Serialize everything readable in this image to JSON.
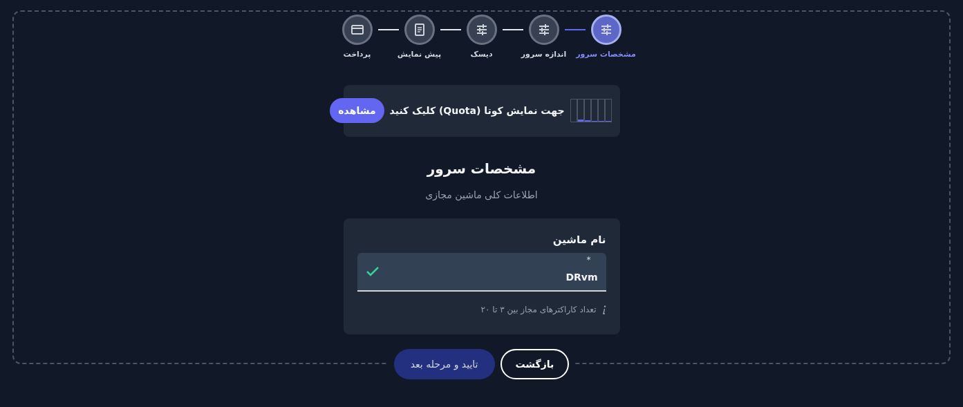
{
  "steps": [
    {
      "label": "مشخصات سرور",
      "kind": "sliders",
      "selected": true
    },
    {
      "label": "اندازه سرور",
      "kind": "sliders",
      "selected": false
    },
    {
      "label": "دیسک",
      "kind": "sliders",
      "selected": false
    },
    {
      "label": "پیش نمایش",
      "kind": "document",
      "selected": false
    },
    {
      "label": "پرداخت",
      "kind": "card",
      "selected": false
    }
  ],
  "quota": {
    "text": "جهت نمایش کوتا (Quota) کلیک کنید",
    "button": "مشاهده"
  },
  "heading": "مشخصات سرور",
  "subheading": "اطلاعات کلی ماشین مجازی",
  "form": {
    "label": "نام ماشین",
    "required_mark": "*",
    "value": "DRvm",
    "valid": true,
    "hint": "تعداد کاراکترهای مجاز بین ۳ تا ۲۰"
  },
  "buttons": [
    {
      "label": "بازگشت",
      "kind": "outline"
    },
    {
      "label": "تایید و مرحله بعد",
      "kind": "primary"
    }
  ]
}
